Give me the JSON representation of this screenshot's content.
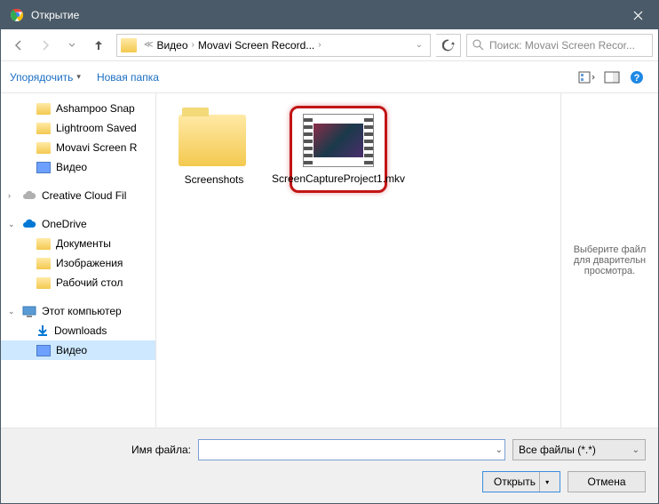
{
  "title": "Открытие",
  "breadcrumb": {
    "part1": "Видео",
    "part2": "Movavi Screen Record..."
  },
  "search_placeholder": "Поиск: Movavi Screen Recor...",
  "toolbar": {
    "organize": "Упорядочить",
    "newfolder": "Новая папка"
  },
  "sidebar": {
    "items": [
      {
        "label": "Ashampoo Snap"
      },
      {
        "label": "Lightroom Saved"
      },
      {
        "label": "Movavi Screen R"
      },
      {
        "label": "Видео"
      }
    ],
    "cloud": "Creative Cloud Fil",
    "onedrive": "OneDrive",
    "od_items": [
      {
        "label": "Документы"
      },
      {
        "label": "Изображения"
      },
      {
        "label": "Рабочий стол"
      }
    ],
    "thispc": "Этот компьютер",
    "pc_items": [
      {
        "label": "Downloads"
      },
      {
        "label": "Видео"
      }
    ]
  },
  "files": {
    "folder": "Screenshots",
    "video": "ScreenCaptureProject1.mkv"
  },
  "preview": "Выберите файл для дварительн просмотра.",
  "filename_label": "Имя файла:",
  "filename_value": "",
  "filter": "Все файлы (*.*)",
  "buttons": {
    "open": "Открыть",
    "cancel": "Отмена"
  }
}
